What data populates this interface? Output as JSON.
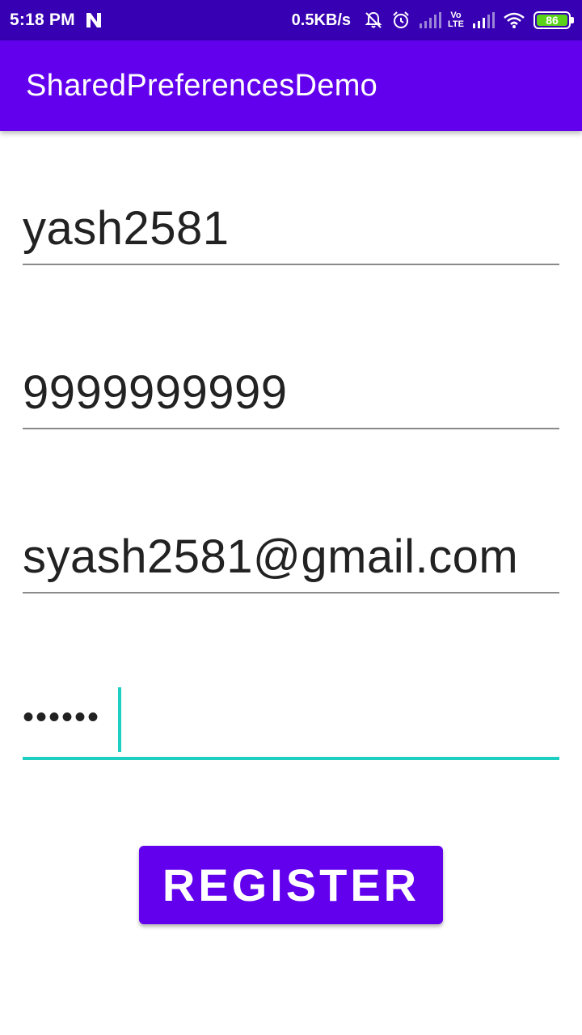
{
  "status_bar": {
    "time": "5:18 PM",
    "notification_icon": "n-logo-icon",
    "net_speed": "0.5KB/s",
    "icons": [
      "notifications-off-icon",
      "alarm-icon",
      "signal-icon",
      "volte-icon",
      "signal-icon",
      "wifi-icon",
      "battery-icon"
    ],
    "volte_top": "Vo",
    "volte_bottom": "LTE",
    "battery": "86",
    "battery_color": "#5bd21a"
  },
  "app_bar": {
    "title": "SharedPreferencesDemo",
    "color": "#6200ee"
  },
  "form": {
    "username": "yash2581",
    "phone": "9999999999",
    "email": "syash2581@gmail.com",
    "password": "••••••",
    "accent_color": "#1ccfc0"
  },
  "register_button": {
    "label": "REGISTER"
  }
}
